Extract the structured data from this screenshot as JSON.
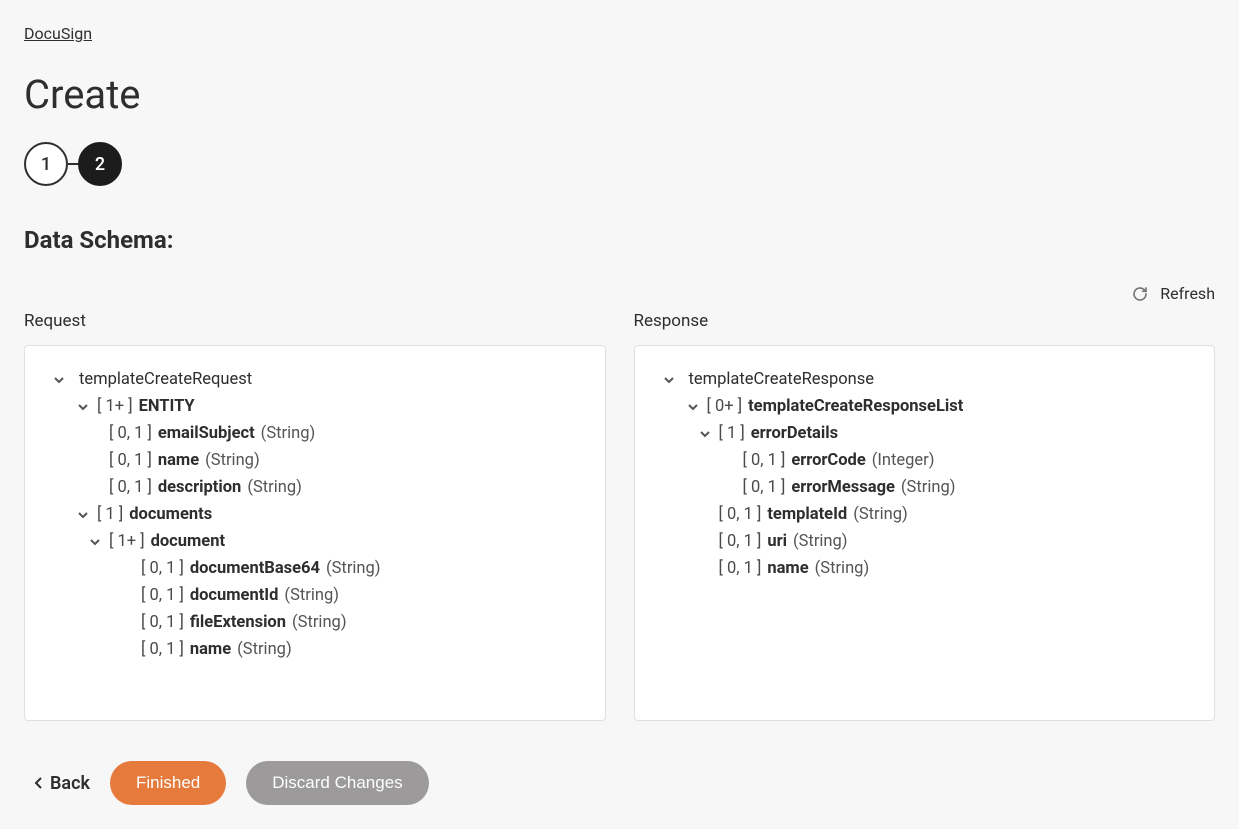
{
  "breadcrumb": "DocuSign",
  "title": "Create",
  "steps": [
    "1",
    "2"
  ],
  "activeStep": 2,
  "sectionLabel": "Data Schema:",
  "refreshLabel": "Refresh",
  "requestLabel": "Request",
  "responseLabel": "Response",
  "requestTree": [
    {
      "indent": 0,
      "chevron": true,
      "card": "",
      "field": "templateCreateRequest",
      "type": "",
      "bold": false
    },
    {
      "indent": 1,
      "chevron": true,
      "card": "[ 1+ ] ",
      "field": "ENTITY",
      "type": "",
      "bold": true
    },
    {
      "indent": 2,
      "chevron": false,
      "card": "[ 0, 1 ] ",
      "field": "emailSubject",
      "type": " (String)",
      "bold": true
    },
    {
      "indent": 2,
      "chevron": false,
      "card": "[ 0, 1 ] ",
      "field": "name",
      "type": " (String)",
      "bold": true
    },
    {
      "indent": 2,
      "chevron": false,
      "card": "[ 0, 1 ] ",
      "field": "description",
      "type": " (String)",
      "bold": true
    },
    {
      "indent": 1,
      "chevron": true,
      "card": "[ 1 ] ",
      "field": "documents",
      "type": "",
      "bold": true
    },
    {
      "indent": 2,
      "chevron": true,
      "card": "[ 1+ ] ",
      "field": "document",
      "type": "",
      "bold": true,
      "extraIndent": true
    },
    {
      "indent": 4,
      "chevron": false,
      "card": "[ 0, 1 ] ",
      "field": "documentBase64",
      "type": " (String)",
      "bold": true
    },
    {
      "indent": 4,
      "chevron": false,
      "card": "[ 0, 1 ] ",
      "field": "documentId",
      "type": " (String)",
      "bold": true
    },
    {
      "indent": 4,
      "chevron": false,
      "card": "[ 0, 1 ] ",
      "field": "fileExtension",
      "type": " (String)",
      "bold": true
    },
    {
      "indent": 4,
      "chevron": false,
      "card": "[ 0, 1 ] ",
      "field": "name",
      "type": " (String)",
      "bold": true
    }
  ],
  "responseTree": [
    {
      "indent": 0,
      "chevron": true,
      "card": "",
      "field": "templateCreateResponse",
      "type": "",
      "bold": false
    },
    {
      "indent": 1,
      "chevron": true,
      "card": "[ 0+ ] ",
      "field": "templateCreateResponseList",
      "type": "",
      "bold": true
    },
    {
      "indent": 2,
      "chevron": true,
      "card": "[ 1 ] ",
      "field": "errorDetails",
      "type": "",
      "bold": true
    },
    {
      "indent": 3,
      "chevron": false,
      "card": "[ 0, 1 ] ",
      "field": "errorCode",
      "type": " (Integer)",
      "bold": true
    },
    {
      "indent": 3,
      "chevron": false,
      "card": "[ 0, 1 ] ",
      "field": "errorMessage",
      "type": " (String)",
      "bold": true
    },
    {
      "indent": 2,
      "chevron": false,
      "card": "[ 0, 1 ] ",
      "field": "templateId",
      "type": " (String)",
      "bold": true,
      "noChevPad": true
    },
    {
      "indent": 2,
      "chevron": false,
      "card": "[ 0, 1 ] ",
      "field": "uri",
      "type": " (String)",
      "bold": true,
      "noChevPad": true
    },
    {
      "indent": 2,
      "chevron": false,
      "card": "[ 0, 1 ] ",
      "field": "name",
      "type": " (String)",
      "bold": true,
      "noChevPad": true
    }
  ],
  "footer": {
    "back": "Back",
    "finished": "Finished",
    "discard": "Discard Changes"
  }
}
